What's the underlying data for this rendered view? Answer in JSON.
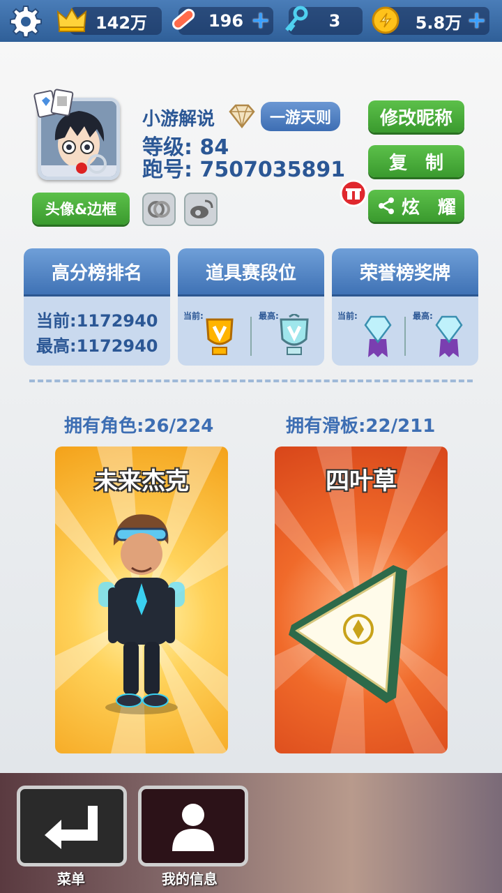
{
  "topbar": {
    "settings_icon": "gear-icon",
    "highscore": "142万",
    "boards": "196",
    "keys": "3",
    "coins": "5.8万"
  },
  "profile": {
    "nickname": "小游解说",
    "title_badge": "一游天则",
    "level": "等级: 84",
    "runner_id": "跑号: 7507035891",
    "avatar_frame_btn": "头像&边框",
    "rename_btn": "修改昵称",
    "copy_btn": "复　制",
    "share_btn": "炫　耀"
  },
  "panels": {
    "highscore": {
      "title": "高分榜排名",
      "current": "当前:1172940",
      "best": "最高:1172940"
    },
    "items": {
      "title": "道具赛段位",
      "current_label": "当前:",
      "best_label": "最高:"
    },
    "honor": {
      "title": "荣誉榜奖牌",
      "current_label": "当前:",
      "best_label": "最高:"
    }
  },
  "collection": {
    "characters_owned": "拥有角色:26/224",
    "boards_owned": "拥有滑板:22/211",
    "character_name": "未来杰克",
    "board_name": "四叶草"
  },
  "nav": {
    "menu": "菜单",
    "my_info": "我的信息"
  },
  "colors": {
    "accent_blue": "#3d6eb3",
    "green_button": "#4cae3c",
    "char_card": "#f9b233",
    "board_card": "#e85a1c"
  }
}
